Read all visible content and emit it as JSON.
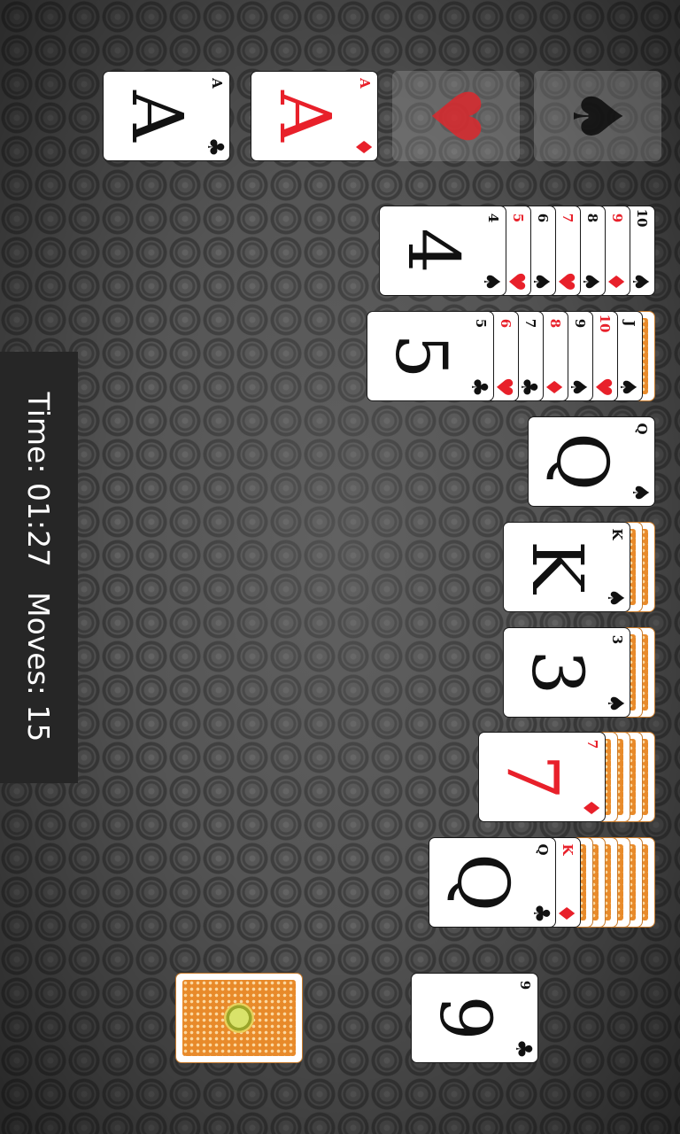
{
  "status": {
    "time_label": "Time:",
    "time_value": "01:27",
    "moves_label": "Moves:",
    "moves_value": "15"
  },
  "foundations": [
    {
      "rank": "A",
      "suit": "♣",
      "color": "black"
    },
    {
      "rank": "A",
      "suit": "♦",
      "color": "red"
    },
    {
      "placeholder": "♥",
      "empty": true
    },
    {
      "placeholder": "♠",
      "empty": true
    }
  ],
  "tableau": [
    {
      "face_down": 0,
      "face_up": [
        {
          "rank": "10",
          "suit": "♠",
          "color": "black"
        },
        {
          "rank": "9",
          "suit": "♦",
          "color": "red"
        },
        {
          "rank": "8",
          "suit": "♠",
          "color": "black"
        },
        {
          "rank": "7",
          "suit": "♥",
          "color": "red"
        },
        {
          "rank": "6",
          "suit": "♠",
          "color": "black"
        },
        {
          "rank": "5",
          "suit": "♥",
          "color": "red"
        },
        {
          "rank": "4",
          "suit": "♠",
          "color": "black"
        }
      ]
    },
    {
      "face_down": 1,
      "face_up": [
        {
          "rank": "J",
          "suit": "♠",
          "color": "black"
        },
        {
          "rank": "10",
          "suit": "♥",
          "color": "red"
        },
        {
          "rank": "9",
          "suit": "♠",
          "color": "black"
        },
        {
          "rank": "8",
          "suit": "♦",
          "color": "red"
        },
        {
          "rank": "7",
          "suit": "♣",
          "color": "black"
        },
        {
          "rank": "6",
          "suit": "♥",
          "color": "red"
        },
        {
          "rank": "5",
          "suit": "♣",
          "color": "black"
        }
      ]
    },
    {
      "face_down": 0,
      "face_up": [
        {
          "rank": "Q",
          "suit": "♠",
          "color": "black"
        }
      ]
    },
    {
      "face_down": 2,
      "face_up": [
        {
          "rank": "K",
          "suit": "♠",
          "color": "black"
        }
      ]
    },
    {
      "face_down": 2,
      "face_up": [
        {
          "rank": "3",
          "suit": "♠",
          "color": "black"
        }
      ]
    },
    {
      "face_down": 4,
      "face_up": [
        {
          "rank": "7",
          "suit": "♦",
          "color": "red"
        }
      ]
    },
    {
      "face_down": 6,
      "face_up": [
        {
          "rank": "K",
          "suit": "♦",
          "color": "red"
        },
        {
          "rank": "Q",
          "suit": "♣",
          "color": "black"
        }
      ]
    }
  ],
  "waste": {
    "rank": "9",
    "suit": "♣",
    "color": "black"
  },
  "stock": {
    "count_visible": 1
  }
}
